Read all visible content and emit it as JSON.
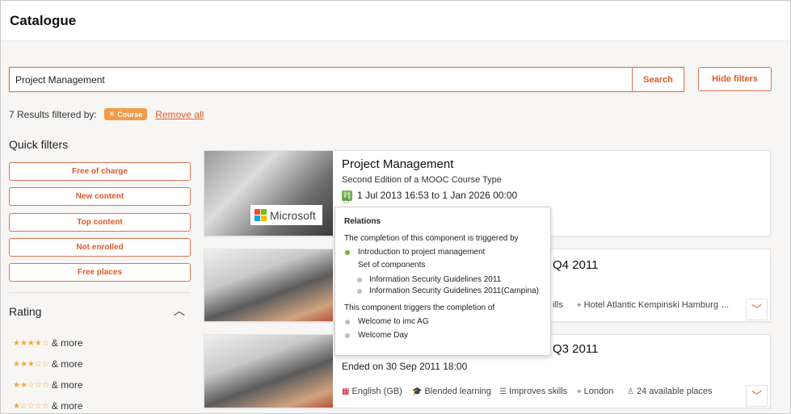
{
  "header": {
    "title": "Catalogue"
  },
  "search": {
    "value": "Project Management",
    "button_label": "Search",
    "hide_filters_label": "Hide filters"
  },
  "results": {
    "text": "7 Results filtered by:",
    "chip_label": "Course",
    "remove_all_label": "Remove all"
  },
  "quick_filters": {
    "title": "Quick filters",
    "items": [
      "Free of charge",
      "New content",
      "Top content",
      "Not enrolled",
      "Free places"
    ]
  },
  "rating": {
    "title": "Rating",
    "rows": [
      {
        "stars": "★★★★☆",
        "label": "& more"
      },
      {
        "stars": "★★★☆☆",
        "label": "& more"
      },
      {
        "stars": "★★☆☆☆",
        "label": "& more"
      },
      {
        "stars": "★☆☆☆☆",
        "label": "& more"
      }
    ]
  },
  "cards": [
    {
      "title": "Project Management",
      "subtitle": "Second Edition of a MOOC Course Type",
      "date": "1 Jul 2013 16:53 to 1 Jan 2026 00:00",
      "logo_text": "Microsoft"
    },
    {
      "title_suffix": "Q4 2011",
      "meta_skill": "ills",
      "location": "Hotel Atlantic Kempinski Hamburg",
      "ellipsis": "..."
    },
    {
      "title_suffix": "Q3 2011",
      "date": "Ended on 30 Sep 2011 18:00",
      "language": "English (GB)",
      "type": "Blended learning",
      "skills": "Improves skills",
      "location": "London",
      "places": "24 available places"
    }
  ],
  "popover": {
    "heading": "Relations",
    "triggered_by_label": "The completion of this component is triggered by",
    "triggered_item": "Introduction to project management",
    "set_label": "Set of components",
    "set_items": [
      "Information Security Guidelines 2011",
      "Information Security Guidelines 2011(Campina)"
    ],
    "triggers_label": "This component triggers the completion of",
    "triggers_items": [
      "Welcome to imc AG",
      "Welcome Day"
    ]
  },
  "colors": {
    "accent": "#e05a2b",
    "chip": "#f39b4a",
    "green": "#6fb24a"
  },
  "icons": {
    "chip_close": "close-icon",
    "relations": "relations-icon",
    "expand": "chevron-down-icon",
    "collapse": "chevron-up-icon",
    "location": "location-pin-icon",
    "language": "uk-flag-icon",
    "type": "graduation-cap-icon",
    "skills": "skills-icon",
    "places": "person-icon"
  }
}
